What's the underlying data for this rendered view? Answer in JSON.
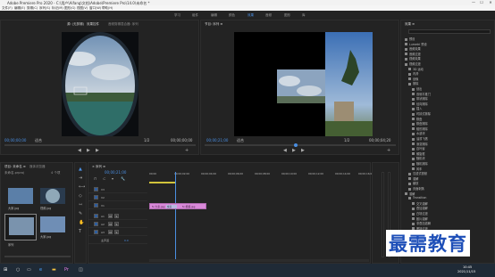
{
  "app": {
    "title": "Adobe Premiere Pro 2020 - C:\\用户\\Aifang\\文档\\Adobe\\Premiere Pro\\14.0\\未命名 *",
    "window_controls": [
      "—",
      "☐",
      "✕"
    ]
  },
  "menu": [
    "文件(F)",
    "编辑(E)",
    "剪辑(C)",
    "序列(S)",
    "标记(M)",
    "图形(G)",
    "视图(V)",
    "窗口(W)",
    "帮助(H)"
  ],
  "workspaces": [
    "学习",
    "组件",
    "编辑",
    "颜色",
    "效果",
    "音频",
    "图形",
    "库"
  ],
  "active_workspace": "效果",
  "toolbar_popup": {
    "icon_names": [
      "folder-icon",
      "view-icon",
      "search-icon",
      "zoom-icon",
      "help-icon",
      "more-icon"
    ]
  },
  "source_monitor": {
    "tab": "源: (无剪辑)",
    "tab2": "效果控件",
    "tab3": "音频剪辑混合器: 序列",
    "timecode_left": "00;00;00;00",
    "fit": "适合",
    "page": "1/2",
    "timecode_right": "00;00;00;00"
  },
  "program_monitor": {
    "tab": "节目: 序列 ≡",
    "timecode_left": "00;00;21;00",
    "fit": "适合",
    "page": "1/2",
    "timecode_right": "00;00;04;20"
  },
  "effects_panel": {
    "title": "效果 ≡",
    "items": [
      "预设",
      "Lumetri 预设",
      "音频效果",
      "音频过渡",
      "视频效果",
      "视频过渡",
      "3D 运动",
      "内滑",
      "划像",
      "擦除",
      "划出",
      "双侧平推门",
      "带状擦除",
      "径向擦除",
      "插入",
      "时钟式擦除",
      "棋盘",
      "棋盘擦除",
      "楔形擦除",
      "水波块",
      "油漆飞溅",
      "渐变擦除",
      "百叶窗",
      "螺旋框",
      "随机块",
      "随机擦除",
      "风车",
      "沉浸式视频",
      "溶解",
      "缩放",
      "页面剥落",
      "溶解",
      "Transition",
      "交叉溶解",
      "叠加溶解",
      "白场过渡",
      "胶片溶解",
      "非叠加溶解",
      "黑场过渡",
      "缩放",
      "交叉缩放",
      "页面剥落",
      "翻页",
      "页面剥落"
    ]
  },
  "project_panel": {
    "tab1": "项目: 未命名 ≡",
    "tab2": "媒体浏览器",
    "path": "未命名.prproj",
    "item_count": "4 个项",
    "clips": [
      {
        "name": "大家.jpg",
        "duration": "4;29"
      },
      {
        "name": "视频.jpg",
        "duration": "4;29"
      },
      {
        "name": "序列",
        "duration": "4;29"
      },
      {
        "name": "大家.jpg",
        "duration": "4;29"
      }
    ]
  },
  "timeline": {
    "tab": "× 序列 ≡",
    "timecode": "00;00;21;00",
    "ruler": [
      "00;00",
      "00;00;02;00",
      "00;00;04;00",
      "00;00;06;00",
      "00;00;08;00",
      "00;00;10;00",
      "00;00;12;00",
      "00;00;14;00",
      "00;00;16;00"
    ],
    "tracks_video": [
      "V3",
      "V2",
      "V1"
    ],
    "tracks_audio": [
      "A1",
      "A2",
      "A3"
    ],
    "master": "主声道",
    "master_value": "0.0",
    "clips": [
      {
        "label": "fx 大家.jpg",
        "track": "V1"
      },
      {
        "label": "fx 视频.jpg",
        "track": "V1"
      }
    ],
    "transition_label": "交叉"
  },
  "taskbar": {
    "time": "10:45",
    "date": "2021/11/15"
  },
  "watermark": "最需教育",
  "colors": {
    "accent": "#4a8fe2",
    "clip_pink": "#d989d9",
    "timeline_blue_bar": "#3f77c9"
  }
}
